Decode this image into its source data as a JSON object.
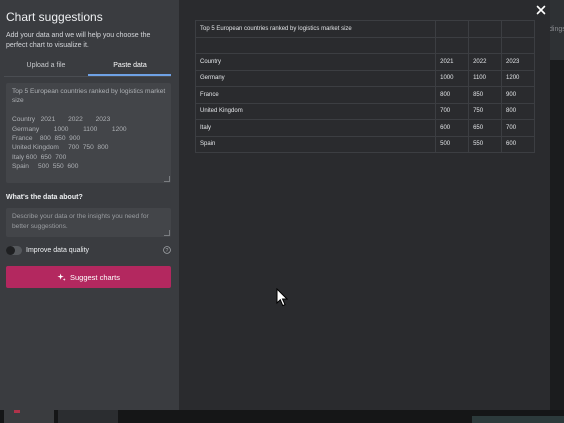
{
  "backdrop": {
    "partial_text": "dings"
  },
  "dialog": {
    "title": "Chart suggestions",
    "subtitle": "Add your data and we will help you choose the perfect chart to visualize it.",
    "tabs": [
      {
        "label": "Upload a file",
        "active": false
      },
      {
        "label": "Paste data",
        "active": true
      }
    ],
    "pasted_data": "Top 5 European countries ranked by logistics market\nsize\n\nCountry   2021       2022       2023\nGermany        1000        1100        1200\nFrance    800  850  900\nUnited Kingdom     700  750  800\nItaly 600  650  700\nSpain     500  550  600",
    "about_label": "What's the data about?",
    "about_placeholder": "Describe your data or the insights you need for better suggestions.",
    "improve_quality": {
      "label": "Improve data quality",
      "enabled": false
    },
    "suggest_button": "Suggest charts",
    "accent_color": "#b3285f",
    "tab_underline_color": "#6fa2e6",
    "icons": {
      "close": "close-icon",
      "help": "help-icon",
      "sparkle": "sparkle-icon"
    }
  },
  "preview_table": {
    "rows": [
      [
        "Top 5 European countries ranked by logistics market size",
        "",
        "",
        ""
      ],
      [
        "",
        "",
        "",
        ""
      ],
      [
        "Country",
        "2021",
        "2022",
        "2023"
      ],
      [
        "Germany",
        "1000",
        "1100",
        "1200"
      ],
      [
        "France",
        "800",
        "850",
        "900"
      ],
      [
        "United Kingdom",
        "700",
        "750",
        "800"
      ],
      [
        "Italy",
        "600",
        "650",
        "700"
      ],
      [
        "Spain",
        "500",
        "550",
        "600"
      ]
    ]
  }
}
